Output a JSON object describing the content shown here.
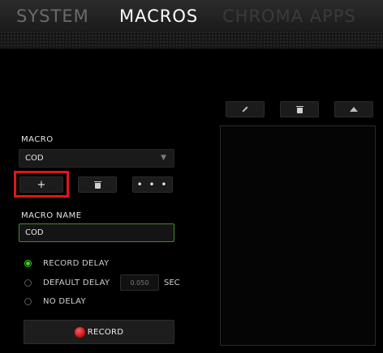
{
  "nav": {
    "tabs": [
      {
        "label": "SYSTEM"
      },
      {
        "label": "MACROS"
      },
      {
        "label": "CHROMA APPS"
      }
    ],
    "active": "MACROS"
  },
  "macro": {
    "label": "MACRO",
    "selected": "COD",
    "add_label": "+",
    "more_label": "• • •"
  },
  "macro_name": {
    "label": "MACRO NAME",
    "value": "COD"
  },
  "delay_options": [
    {
      "label": "RECORD DELAY",
      "selected": true
    },
    {
      "label": "DEFAULT DELAY",
      "selected": false
    },
    {
      "label": "NO DELAY",
      "selected": false
    }
  ],
  "default_delay": {
    "value": "0.050",
    "unit": "SEC"
  },
  "record": {
    "label": "RECORD"
  },
  "colors": {
    "accent": "#44d62c",
    "highlight": "#e1141c"
  },
  "icons": {
    "dropdown": "chevron-down-icon",
    "delete": "trash-icon",
    "edit": "pencil-icon",
    "move_up": "arrow-up-icon",
    "record": "record-dot-icon"
  }
}
